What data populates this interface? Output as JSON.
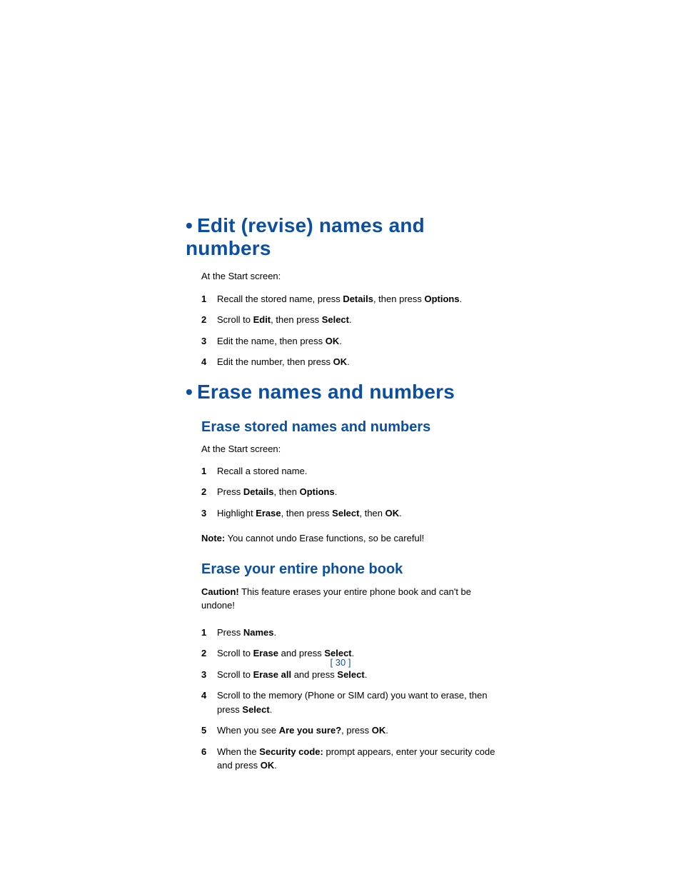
{
  "section1": {
    "title": "Edit (revise) names and numbers",
    "intro": "At the Start screen:",
    "steps": [
      {
        "pre": "Recall the stored name, press ",
        "b1": "Details",
        "mid": ", then press ",
        "b2": "Options",
        "post": "."
      },
      {
        "pre": "Scroll to ",
        "b1": "Edit",
        "mid": ", then press ",
        "b2": "Select",
        "post": "."
      },
      {
        "pre": "Edit the name, then press ",
        "b1": "OK",
        "post": "."
      },
      {
        "pre": "Edit the number, then press ",
        "b1": "OK",
        "post": "."
      }
    ]
  },
  "section2": {
    "title": "Erase names and numbers",
    "sub1": {
      "title": "Erase stored names and numbers",
      "intro": "At the Start screen:",
      "steps": [
        {
          "pre": "Recall a stored name."
        },
        {
          "pre": "Press ",
          "b1": "Details",
          "mid": ", then  ",
          "b2": "Options",
          "post": "."
        },
        {
          "pre": "Highlight ",
          "b1": "Erase",
          "mid": ", then press ",
          "b2": "Select",
          "mid2": ", then ",
          "b3": "OK",
          "post": "."
        }
      ],
      "note_label": "Note:",
      "note_text": "  You cannot undo Erase functions, so be careful!"
    },
    "sub2": {
      "title": "Erase your entire phone book",
      "caution_label": "Caution!",
      "caution_text": "  This feature erases your entire phone book and can't be undone!",
      "steps": [
        {
          "pre": "Press ",
          "b1": "Names",
          "post": "."
        },
        {
          "pre": "Scroll to ",
          "b1": "Erase",
          "mid": " and press ",
          "b2": "Select",
          "post": "."
        },
        {
          "pre": "Scroll to ",
          "b1": "Erase all",
          "mid": " and press ",
          "b2": "Select",
          "post": "."
        },
        {
          "pre": "Scroll to the memory (Phone or SIM card) you want to erase, then press ",
          "b1": "Select",
          "post": "."
        },
        {
          "pre": "When you see ",
          "b1": "Are you sure?",
          "mid": ", press ",
          "b2": "OK",
          "post": "."
        },
        {
          "pre": "When the ",
          "b1": "Security code:",
          "mid": " prompt appears, enter your security code and press ",
          "b2": "OK",
          "post": "."
        }
      ]
    }
  },
  "page_number": "[ 30 ]"
}
